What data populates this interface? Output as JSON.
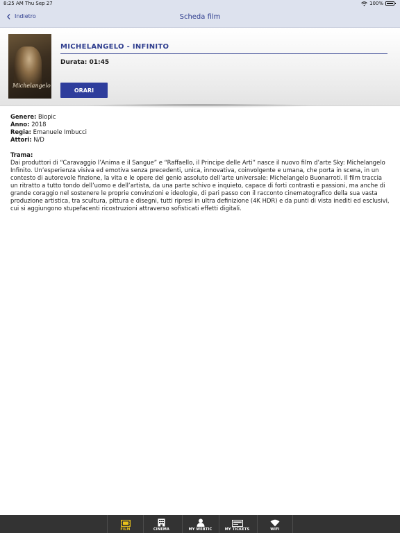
{
  "status_bar": {
    "time": "8:25 AM",
    "date": "Thu Sep 27",
    "battery": "100%"
  },
  "nav": {
    "back_label": "Indietro",
    "title": "Scheda film"
  },
  "film": {
    "title": "MICHELANGELO - INFINITO",
    "duration": "Durata: 01:45",
    "showtimes_button": "ORARI",
    "poster_text": "Michelangelo"
  },
  "details": {
    "genre_label": "Genere:",
    "genre_value": "Biopic",
    "year_label": "Anno:",
    "year_value": "2018",
    "director_label": "Regia:",
    "director_value": "Emanuele Imbucci",
    "actors_label": "Attori:",
    "actors_value": "N/D",
    "plot_label": "Trama:",
    "plot_text": "Dai produttori di “Caravaggio l’Anima e il Sangue” e “Raffaello, il Principe delle Arti” nasce il nuovo film d’arte Sky: Michelangelo Infinito. Un’esperienza visiva ed emotiva senza precedenti, unica, innovativa, coinvolgente e umana, che porta in scena, in un contesto di autorevole finzione, la vita e le opere del genio assoluto dell’arte universale: Michelangelo Buonarroti. Il film traccia un ritratto a tutto tondo dell’uomo e dell’artista, da una parte schivo e inquieto, capace di forti contrasti e passioni, ma anche di grande coraggio nel sostenere le proprie convinzioni e ideologie, di pari passo con il racconto cinematografico della sua vasta produzione artistica, tra scultura, pittura e disegni, tutti ripresi in ultra definizione (4K HDR) e da punti di vista inediti ed esclusivi, cui si aggiungono stupefacenti ricostruzioni attraverso sofisticati effetti digitali."
  },
  "tabs": [
    {
      "label": "FILM",
      "icon": "film-icon",
      "active": true
    },
    {
      "label": "CINEMA",
      "icon": "building-icon",
      "active": false
    },
    {
      "label": "MY WEBTIC",
      "icon": "user-icon",
      "active": false
    },
    {
      "label": "MY TICKETS",
      "icon": "ticket-icon",
      "active": false
    },
    {
      "label": "WIFI",
      "icon": "wifi-icon",
      "active": false
    }
  ],
  "colors": {
    "accent": "#2e3d8e",
    "button": "#2e3d9c",
    "active_tab": "#e8c21a",
    "tab_bar": "#333333"
  }
}
